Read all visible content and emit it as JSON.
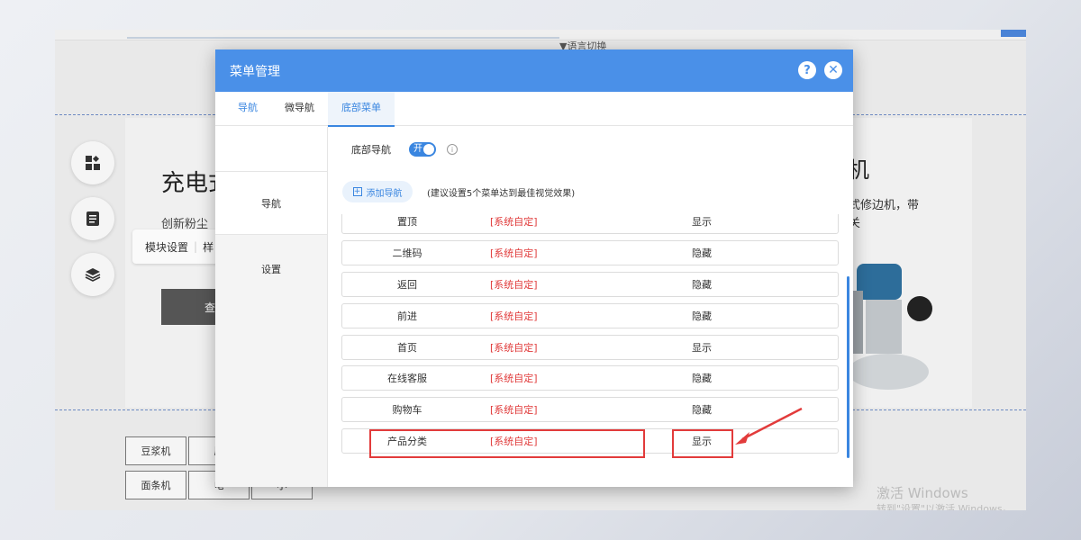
{
  "background_page": {
    "top_switch": "▼语言切换",
    "hero_title": "充电式",
    "hero_sub": "创新粉尘",
    "module_bar": {
      "item1": "模块设置",
      "item2": "样"
    },
    "view_button": "查看",
    "right_title": "机",
    "right_text_line1": "入式修边机，带",
    "right_text_line2": "开关",
    "chips": [
      "豆浆机",
      "原",
      "面条机",
      "电",
      "小"
    ],
    "watermark_line1": "激活 Windows",
    "watermark_line2": "转到\"设置\"以激活 Windows。"
  },
  "modal": {
    "title": "菜单管理",
    "help_label": "?",
    "close_label": "✕",
    "tabs": [
      {
        "label": "导航"
      },
      {
        "label": "微导航"
      },
      {
        "label": "底部菜单"
      }
    ],
    "side_items": [
      {
        "label": "导航"
      },
      {
        "label": "设置"
      }
    ],
    "toggle": {
      "label": "底部导航",
      "state": "开",
      "info_icon": "info-icon"
    },
    "add_button": "添加导航",
    "hint": "(建议设置5个菜单达到最佳视觉效果)",
    "rows": [
      {
        "name": "置顶",
        "source": "[系统自定]",
        "status": "显示"
      },
      {
        "name": "二维码",
        "source": "[系统自定]",
        "status": "隐藏"
      },
      {
        "name": "返回",
        "source": "[系统自定]",
        "status": "隐藏"
      },
      {
        "name": "前进",
        "source": "[系统自定]",
        "status": "隐藏"
      },
      {
        "name": "首页",
        "source": "[系统自定]",
        "status": "显示"
      },
      {
        "name": "在线客服",
        "source": "[系统自定]",
        "status": "隐藏"
      },
      {
        "name": "购物车",
        "source": "[系统自定]",
        "status": "隐藏"
      },
      {
        "name": "产品分类",
        "source": "[系统自定]",
        "status": "显示"
      }
    ]
  },
  "colors": {
    "accent": "#4a90e8",
    "highlight_red": "#e23b3b",
    "system_text_red": "#e03a3a"
  }
}
